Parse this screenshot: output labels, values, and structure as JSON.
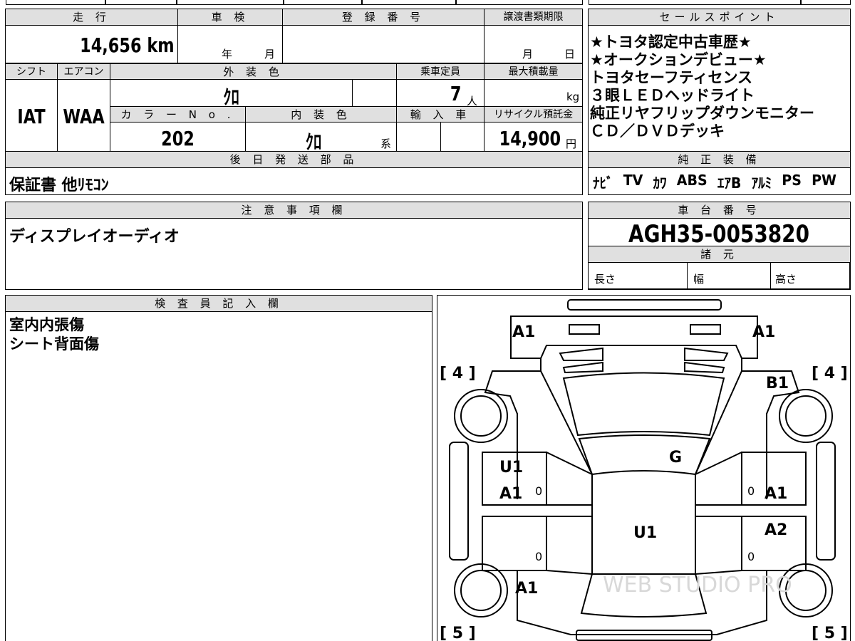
{
  "vehicle_info": {
    "headers": {
      "mileage": "走 行",
      "inspection": "車 検",
      "registration": "登 録 番 号",
      "transfer_deadline": "譲渡書類期限",
      "shift": "シフト",
      "aircon": "エアコン",
      "exterior_color": "外 装 色",
      "capacity": "乗車定員",
      "max_load": "最大積載量",
      "color_no": "カ ラ ー N o .",
      "interior_color": "内 装 色",
      "import": "輸 入 車",
      "recycle": "リサイクル預託金",
      "delivery_parts": "後 日 発 送 部 品"
    },
    "mileage_value": "14,656 km",
    "inspection_year_unit": "年",
    "inspection_month_unit": "月",
    "transfer_month_unit": "月",
    "transfer_day_unit": "日",
    "shift_value": "IAT",
    "aircon_value": "WAA",
    "exterior_color_value": "ｸﾛ",
    "capacity_value": "7",
    "capacity_unit": "人",
    "max_load_unit": "kg",
    "color_no_value": "202",
    "interior_color_value": "ｸﾛ",
    "interior_color_unit": "系",
    "recycle_value": "14,900",
    "recycle_unit": "円",
    "delivery_parts_value": "保証書 他ﾘﾓｺﾝ"
  },
  "sales_points": {
    "header": "セールスポイント",
    "lines": [
      "★トヨタ認定中古車歴★",
      "★オークションデビュー★",
      "トヨタセーフティセンス",
      "３眼ＬＥＤヘッドライト",
      "純正リヤフリップダウンモニター",
      "ＣＤ／ＤＶＤデッキ"
    ]
  },
  "genuine_equipment": {
    "header": "純 正 装 備",
    "items": [
      "ﾅﾋﾞ",
      "TV",
      "ｶﾜ",
      "ABS",
      "ｴｱB",
      "ｱﾙﾐ",
      "PS",
      "PW"
    ]
  },
  "notes": {
    "header": "注 意 事 項 欄",
    "text": "ディスプレイオーディオ"
  },
  "chassis": {
    "header": "車 台 番 号",
    "value": "AGH35-0053820",
    "specs_header": "諸 元",
    "length_label": "長さ",
    "width_label": "幅",
    "height_label": "高さ"
  },
  "inspector": {
    "header": "検 査 員 記 入 欄",
    "lines": [
      "室内内張傷",
      "シート背面傷"
    ]
  },
  "diagram": {
    "marks": {
      "front_left": "A1",
      "front_right": "A1",
      "right_front_fender": "B1",
      "windshield": "G",
      "left_front_door_1": "U1",
      "left_front_door_2": "A1",
      "right_front_door": "A1",
      "right_rear_door": "A2",
      "roof": "U1",
      "left_rear_quarter": "A1"
    },
    "tire_front_left": "[ 4 ]",
    "tire_front_right": "[ 4 ]",
    "tire_rear_left": "[ 5 ]",
    "tire_rear_right": "[ 5 ]",
    "zero_mark": "0",
    "watermark": "WEB STUDIO PRO"
  }
}
